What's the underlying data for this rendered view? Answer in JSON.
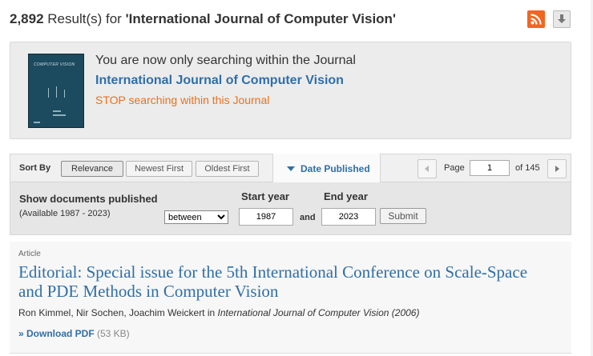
{
  "header": {
    "count": "2,892",
    "results_text": " Result(s) for ",
    "query": "'International Journal of Computer Vision'"
  },
  "icons": {
    "rss": "rss-icon",
    "download": "download-arrow-icon"
  },
  "journal_box": {
    "notice": "You are now only searching within the Journal",
    "journal_name": "International Journal of Computer Vision",
    "stop_link": "STOP searching within this Journal",
    "cover_title": "COMPUTER VISION"
  },
  "sort": {
    "label": "Sort By",
    "relevance": "Relevance",
    "newest": "Newest First",
    "oldest": "Oldest First",
    "date_published": "Date Published",
    "page_label": "Page",
    "page_value": "1",
    "of_pages": "of 145"
  },
  "filter": {
    "show_docs": "Show documents published",
    "available": "(Available 1987 - 2023)",
    "mode": "between",
    "start_label": "Start year",
    "end_label": "End year",
    "start_value": "1987",
    "end_value": "2023",
    "and": "and",
    "submit": "Submit"
  },
  "article": {
    "type": "Article",
    "title": "Editorial: Special issue for the 5th International Conference on Scale-Space and PDE Methods in Computer Vision",
    "authors": "Ron Kimmel, Nir Sochen, Joachim Weickert in ",
    "journal": "International Journal of Computer Vision (2006)",
    "pdf_link": "» Download PDF",
    "pdf_size": "(53 KB)"
  },
  "colors": {
    "link": "#2f6fa7",
    "stop": "#e9711c",
    "rss": "#f26522"
  }
}
